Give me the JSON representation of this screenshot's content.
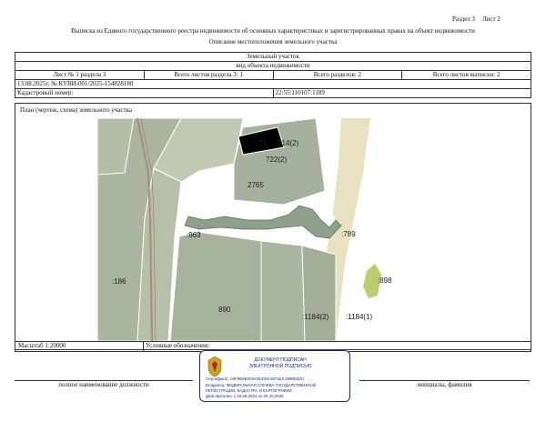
{
  "page": {
    "section_label": "Раздел 3",
    "sheet_label": "Лист 2",
    "title": "Выписка из Единого государственного реестра недвижимости об основных характеристиках и зарегистрированных правах на объект недвижимости",
    "subtitle": "Описание местоположения земельного участка"
  },
  "header": {
    "object_type": "Земельный участок",
    "object_caption": "вид объекта недвижимости",
    "sheet_of_section": "Лист № 1 раздела 3",
    "total_sheets_section": "Всего листов раздела 3: 1",
    "total_sections": "Всего разделов: 2",
    "total_sheets_extract": "Всего листов выписки: 2",
    "date_ref": "13.08.2025г. № КУВИ-001/2025-154828180",
    "cadastral_label": "Кадастровый номер:",
    "cadastral_value": "22:55:110107:1189"
  },
  "plan": {
    "label": "План (чертеж, схема) земельного участка",
    "scale": "Масштаб 1:20000",
    "legend_label": "Условные обозначения:",
    "parcels": [
      "71",
      "714(2)",
      "722(2)",
      "2765",
      ":963",
      ":789",
      ":898",
      ":186",
      "890",
      ":1184(2)",
      ":1184(1)"
    ]
  },
  "footer": {
    "position_caption": "полное наименование должности",
    "name_caption": "инициалы, фамилия"
  },
  "stamp": {
    "line1": "ДОКУМЕНТ ПОДПИСАН",
    "line2": "ЭЛЕКТРОННОЙ ПОДПИСЬЮ",
    "cert": "Сертификат: 00F9B8E0C8A8CD0A4971E2 1998E5D0",
    "owner_line1": "Владелец: ФЕДЕРАЛЬНАЯ СЛУЖБА ГОСУДАРСТВЕННОЙ",
    "owner_line2": "РЕГИСТРАЦИИ, КАДАСТРА И КАРТОГРАФИИ",
    "valid": "Действителен: с 02.08.2024 по 26.10.2025"
  }
}
